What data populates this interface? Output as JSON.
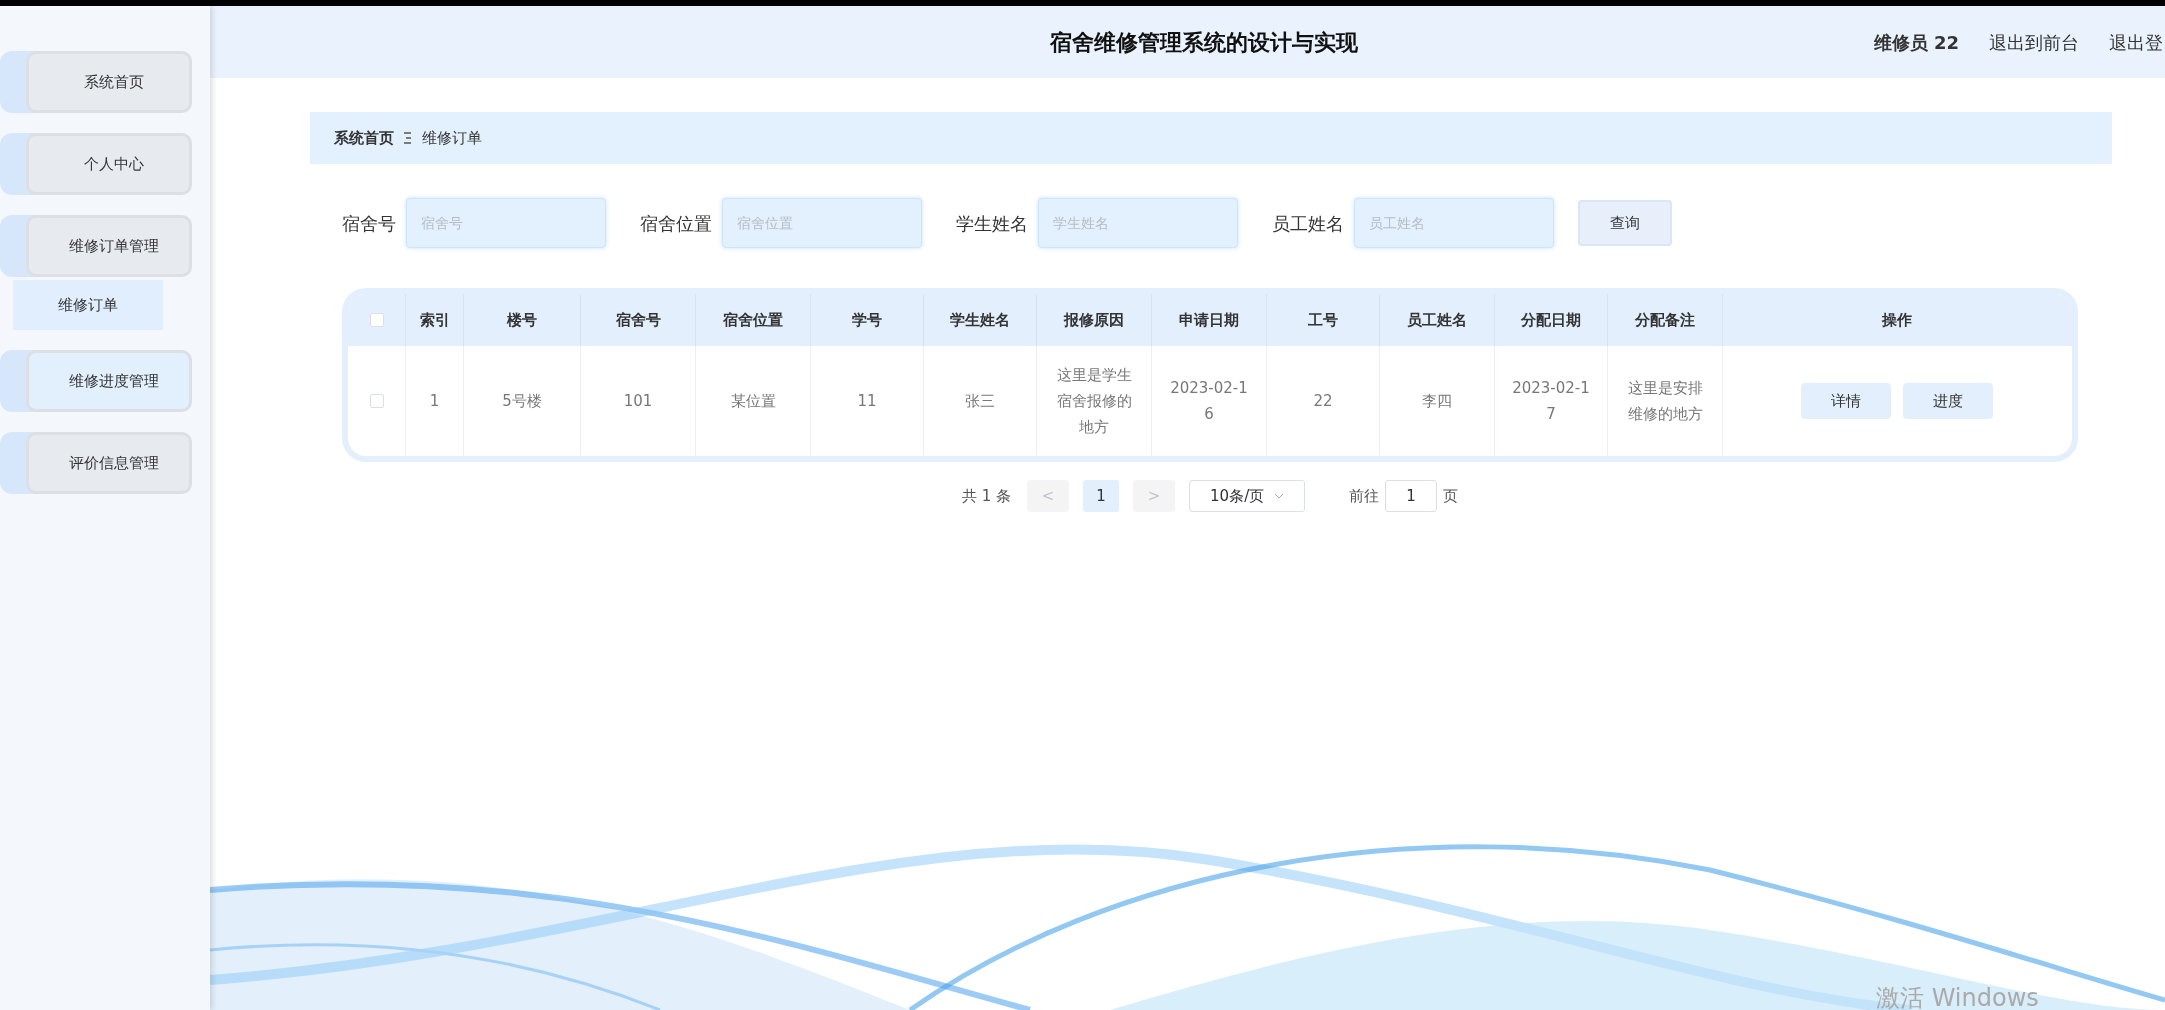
{
  "header": {
    "title": "宿舍维修管理系统的设计与实现",
    "user": "维修员 22",
    "links": [
      "退出到前台",
      "退出登"
    ]
  },
  "sidebar": {
    "items": [
      {
        "label": "系统首页",
        "hovered": false
      },
      {
        "label": "个人中心",
        "hovered": false
      },
      {
        "label": "维修订单管理",
        "hovered": false,
        "children": [
          {
            "label": "维修订单",
            "selected": true
          }
        ]
      },
      {
        "label": "维修进度管理",
        "hovered": true
      },
      {
        "label": "评价信息管理",
        "hovered": false
      }
    ]
  },
  "breadcrumb": [
    "系统首页",
    "维修订单"
  ],
  "search": {
    "fields": [
      {
        "label": "宿舍号",
        "placeholder": "宿舍号"
      },
      {
        "label": "宿舍位置",
        "placeholder": "宿舍位置"
      },
      {
        "label": "学生姓名",
        "placeholder": "学生姓名"
      },
      {
        "label": "员工姓名",
        "placeholder": "员工姓名"
      }
    ],
    "button": "查询"
  },
  "table": {
    "select_all_checked": false,
    "columns": [
      "索引",
      "楼号",
      "宿舍号",
      "宿舍位置",
      "学号",
      "学生姓名",
      "报修原因",
      "申请日期",
      "工号",
      "员工姓名",
      "分配日期",
      "分配备注",
      "操作"
    ],
    "rows": [
      {
        "checked": false,
        "cells": [
          "1",
          "5号楼",
          "101",
          "某位置",
          "11",
          "张三",
          "这里是学生宿舍报修的地方",
          "2023-02-16",
          "22",
          "李四",
          "2023-02-17",
          "这里是安排维修的地方"
        ],
        "actions": [
          "详情",
          "进度"
        ]
      }
    ]
  },
  "pagination": {
    "total": "共 1 条",
    "prev": {
      "label": "<",
      "disabled": true
    },
    "pages": [
      {
        "label": "1",
        "selected": true
      }
    ],
    "next": {
      "label": ">",
      "disabled": true
    },
    "page_size": "10条/页",
    "goto_label": "前往",
    "goto_value": "1",
    "goto_suffix": "页"
  },
  "os_watermark": "激活 Windows"
}
